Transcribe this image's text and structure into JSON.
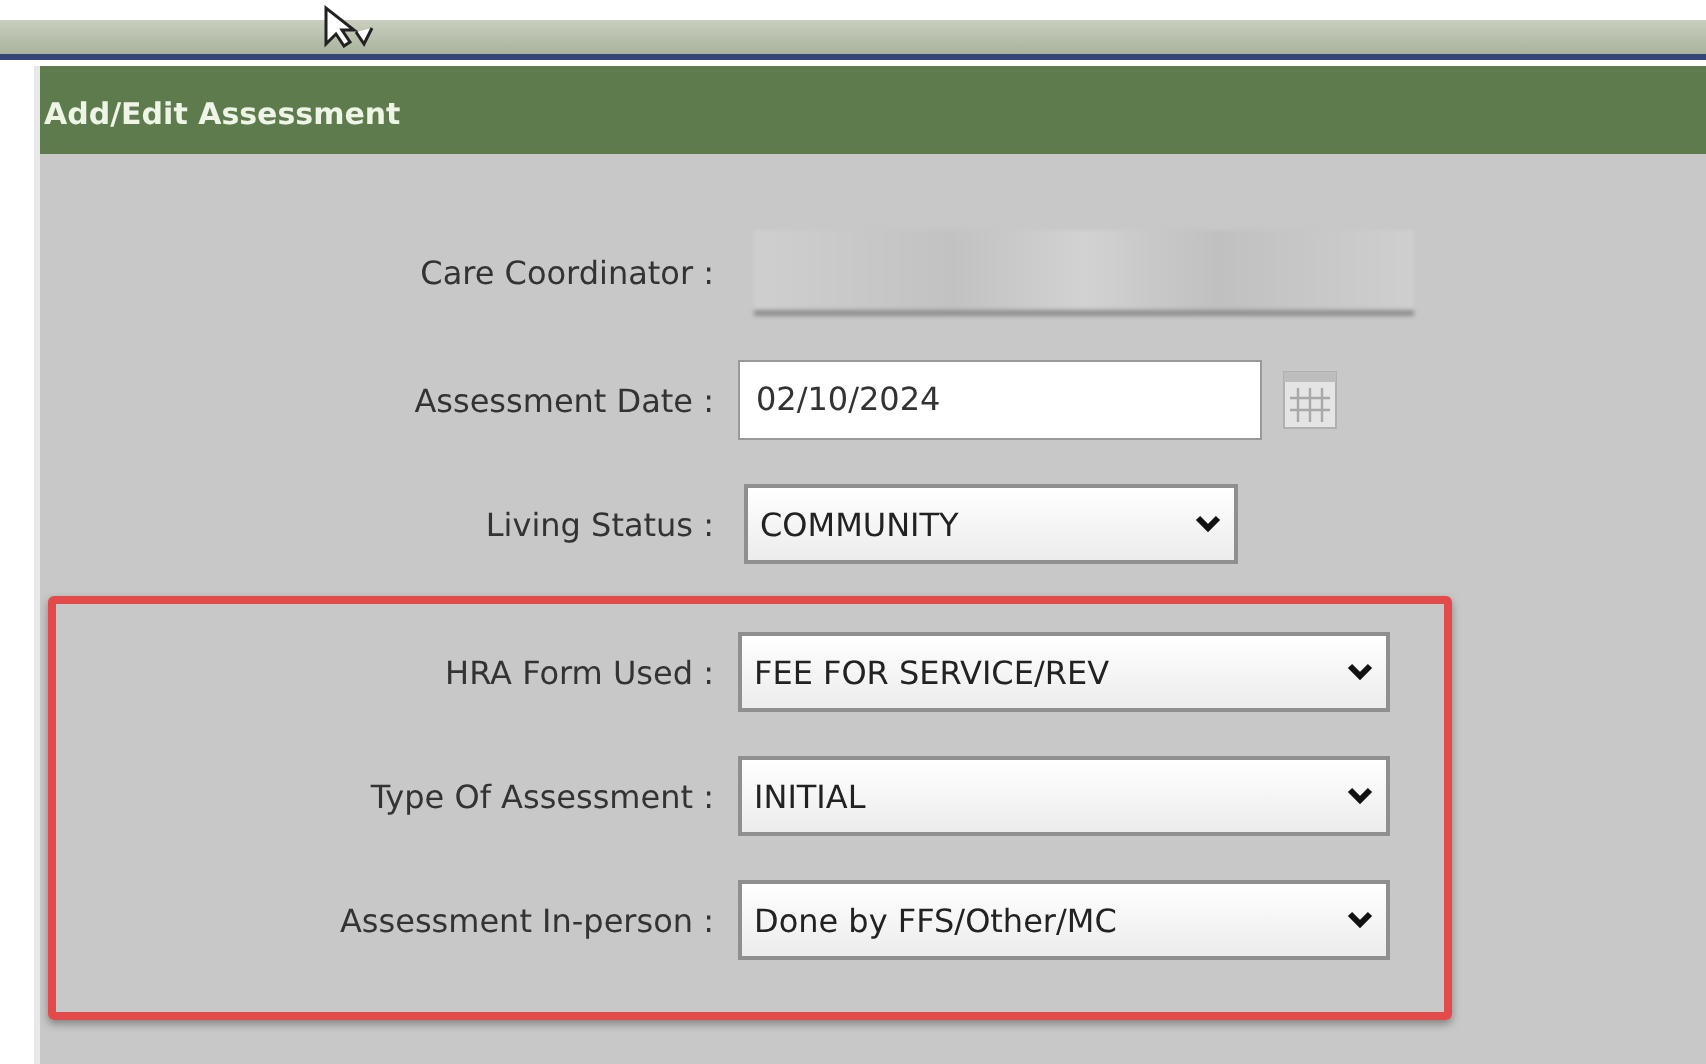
{
  "panel": {
    "title": "Add/Edit Assessment"
  },
  "fields": [
    {
      "label": "Care Coordinator :",
      "kind": "blurred"
    },
    {
      "label": "Assessment Date :",
      "kind": "date",
      "value": "02/10/2024"
    },
    {
      "label": "Living Status :",
      "kind": "compact",
      "value": "COMMUNITY"
    }
  ],
  "highlighted_fields": [
    {
      "label": "HRA Form Used :",
      "kind": "select",
      "value": "FEE FOR SERVICE/REV"
    },
    {
      "label": "Type Of Assessment :",
      "kind": "select",
      "value": "INITIAL"
    },
    {
      "label": "Assessment In-person :",
      "kind": "select",
      "value": "Done by FFS/Other/MC"
    }
  ]
}
